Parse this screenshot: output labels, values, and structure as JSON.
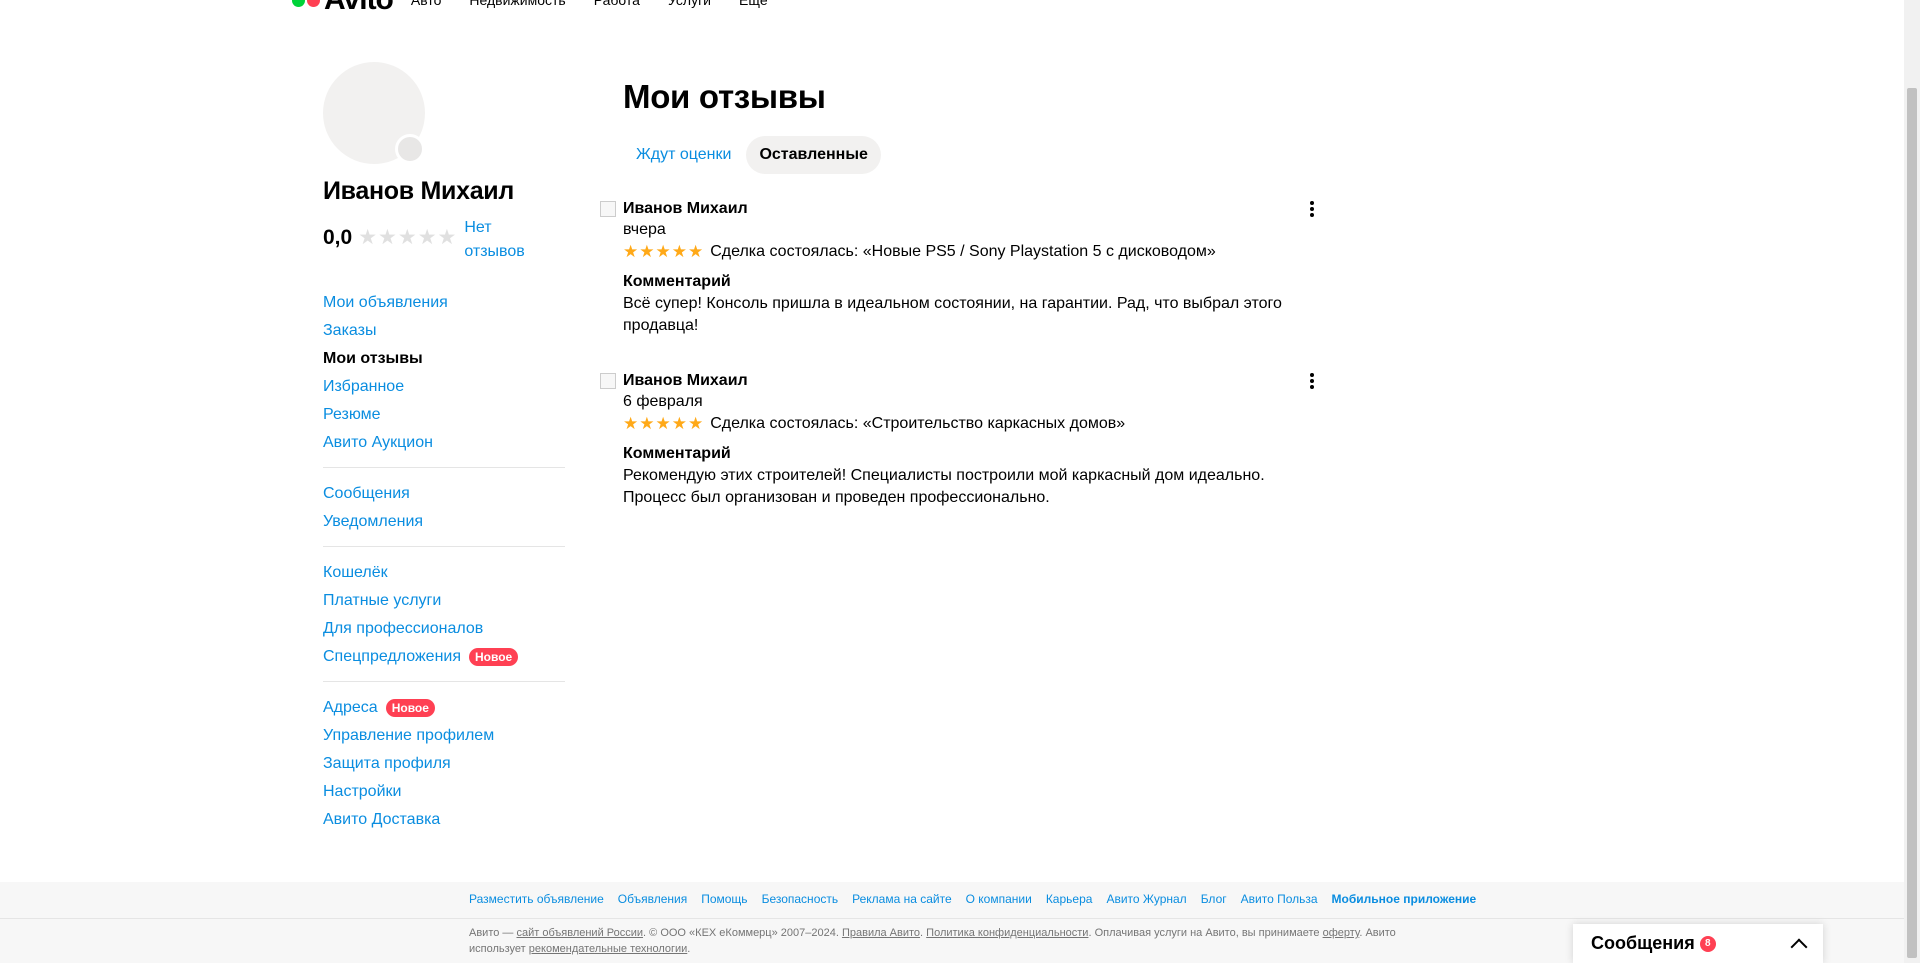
{
  "topnav": {
    "logo_text": "Avito",
    "links": [
      "Авто",
      "Недвижимость",
      "Работа",
      "Услуги",
      "Ещё"
    ]
  },
  "colors": {
    "accent": "#0a8de0",
    "star": "#ffa918",
    "badge": "#ff4053",
    "logo_green": "#00d339",
    "logo_red": "#ff4053"
  },
  "profile": {
    "name": "Иванов Михаил",
    "rating": "0,0",
    "no_reviews": "Нет отзывов"
  },
  "menu": {
    "group1": [
      "Мои объявления",
      "Заказы",
      "Мои отзывы",
      "Избранное",
      "Резюме",
      "Авито Аукцион"
    ],
    "group2": [
      "Сообщения",
      "Уведомления"
    ],
    "group3": [
      "Кошелёк",
      "Платные услуги",
      "Для профессионалов",
      "Спецпредложения"
    ],
    "group4": [
      "Адреса",
      "Управление профилем",
      "Защита профиля",
      "Настройки",
      "Авито Доставка"
    ],
    "badge_new": "Новое"
  },
  "main": {
    "title": "Мои отзывы",
    "tabs": [
      "Ждут оценки",
      "Оставленные"
    ]
  },
  "reviews": [
    {
      "author": "Иванов Михаил",
      "date": "вчера",
      "rating": 5,
      "deal": "Сделка состоялась: «Новые PS5 / Sony Playstation 5 с дисководом»",
      "comment_title": "Комментарий",
      "comment": "Всё супер! Консоль пришла в идеальном состоянии, на гарантии. Рад, что выбрал этого продавца!"
    },
    {
      "author": "Иванов Михаил",
      "date": "6 февраля",
      "rating": 5,
      "deal": "Сделка состоялась: «Строительство каркасных домов»",
      "comment_title": "Комментарий",
      "comment": "Рекомендую этих строителей! Специалисты построили мой каркасный дом идеально. Процесс был организован и проведен профессионально."
    }
  ],
  "footer": {
    "links": [
      "Разместить объявление",
      "Объявления",
      "Помощь",
      "Безопасность",
      "Реклама на сайте",
      "О компании",
      "Карьера",
      "Авито Журнал",
      "Блог",
      "Авито Польза",
      "Мобильное приложение"
    ],
    "legal_1": "Авито — ",
    "legal_link_1": "сайт объявлений России",
    "legal_2": ". © ООО «КЕХ еКоммерц» 2007–2024. ",
    "legal_link_2": "Правила Авито",
    "legal_3": ". ",
    "legal_link_3": "Политика конфиденциальности",
    "legal_4": ". Оплачивая услуги на Авито, вы принимаете ",
    "legal_link_4": "оферту",
    "legal_5": ". Авито использует ",
    "legal_link_5": "рекомендательные технологии",
    "legal_6": "."
  },
  "messages_widget": {
    "title": "Сообщения",
    "count": "8"
  }
}
